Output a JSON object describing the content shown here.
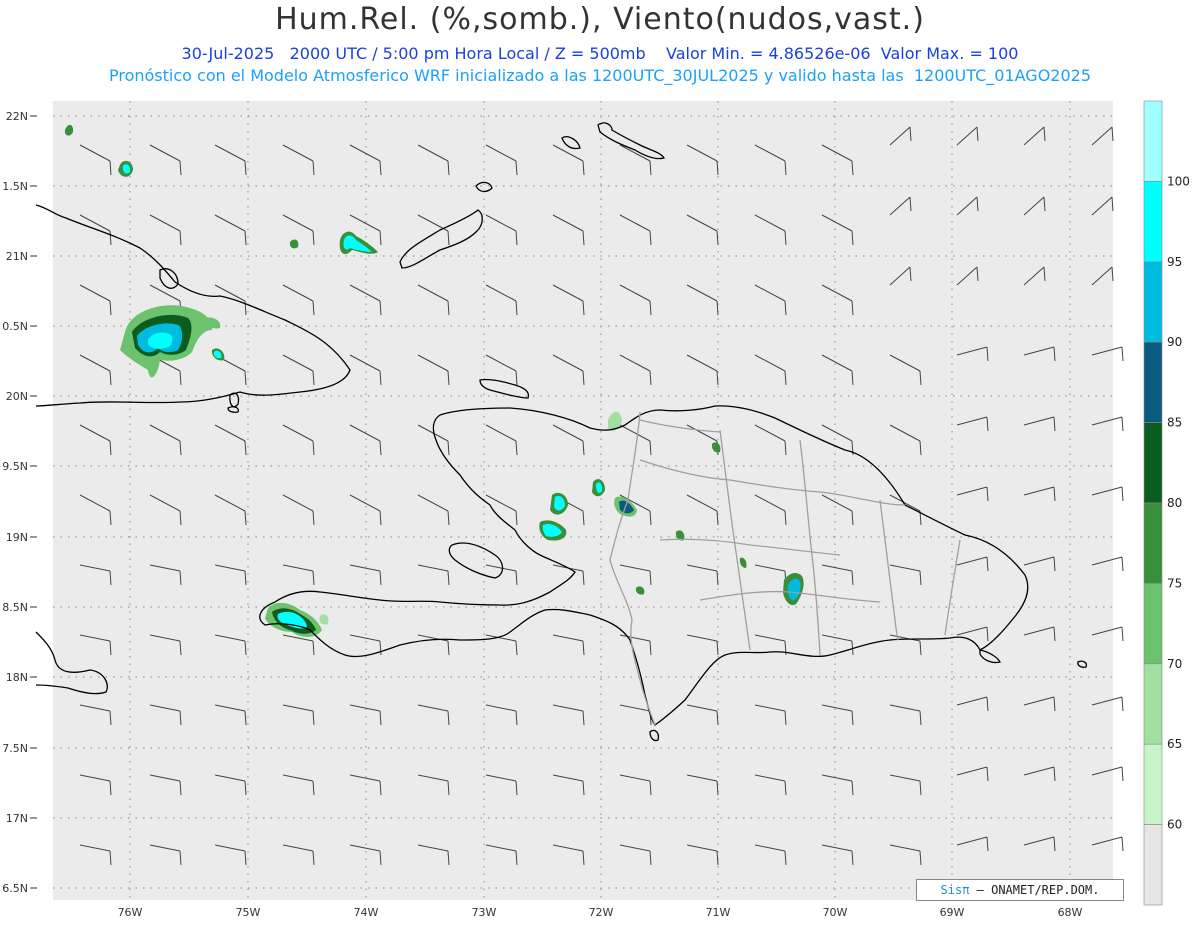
{
  "title": "Hum.Rel. (%,somb.), Viento(nudos,vast.)",
  "subtitle_line1": "30-Jul-2025   2000 UTC / 5:00 pm Hora Local / Z = 500mb    Valor Min. = 4.86526e-06  Valor Max. = 100",
  "subtitle_line2": "Pronóstico con el Modelo Atmosferico WRF inicializado a las 1200UTC_30JUL2025 y valido hasta las  1200UTC_01AGO2025",
  "credit": {
    "brand": "Sisπ",
    "text": "– ONAMET/REP.DOM."
  },
  "axes": {
    "lat_labels": [
      "22N",
      "1.5N",
      "21N",
      "0.5N",
      "20N",
      "9.5N",
      "19N",
      "8.5N",
      "18N",
      "7.5N",
      "17N",
      "6.5N"
    ],
    "lon_labels": [
      "76W",
      "75W",
      "74W",
      "73W",
      "72W",
      "71W",
      "70W",
      "69W",
      "68W"
    ]
  },
  "colorbar": {
    "labels": [
      "60",
      "65",
      "70",
      "75",
      "80",
      "85",
      "90",
      "95",
      "100"
    ],
    "colors": [
      "#e6e6e6",
      "#c8f5c8",
      "#a0e0a0",
      "#6dc26d",
      "#3a8f3a",
      "#0b5d1e",
      "#0b5a80",
      "#00bbe0",
      "#00ffff",
      "#a0ffff"
    ]
  },
  "colors": {
    "background": "#ebebeb",
    "coast": "#000000",
    "border": "#a0a0a0",
    "title": "#333333",
    "subtitle1": "#1a3fe0",
    "subtitle2": "#1aa0ff"
  }
}
